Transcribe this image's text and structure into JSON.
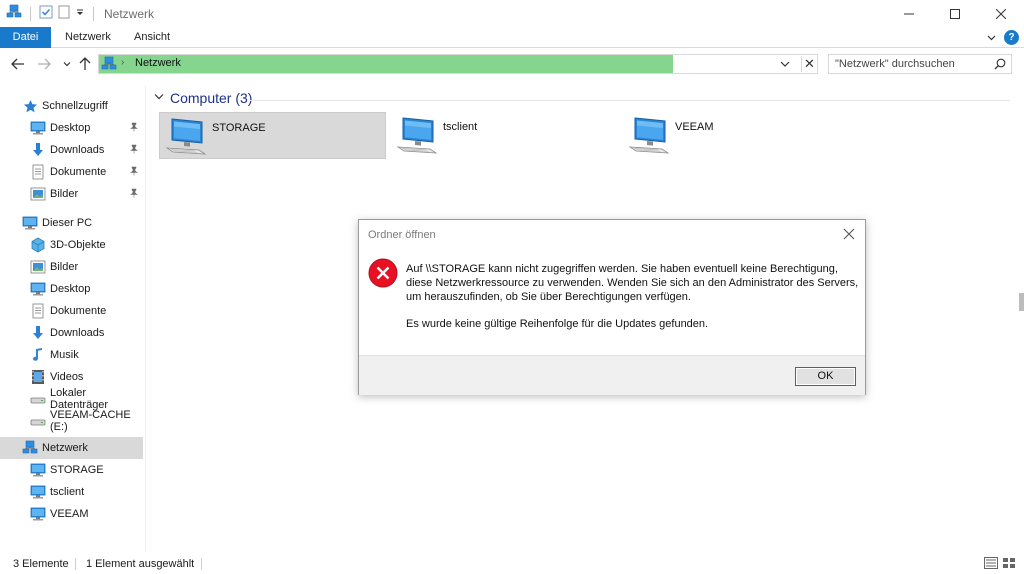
{
  "window": {
    "title": "Netzwerk"
  },
  "ribbon": {
    "tabs": [
      {
        "label": "Datei"
      },
      {
        "label": "Netzwerk"
      },
      {
        "label": "Ansicht"
      }
    ],
    "help_label": "?"
  },
  "address": {
    "path": "Netzwerk",
    "progress_fraction": 0.8,
    "progress_color": "#86d58f"
  },
  "search": {
    "placeholder": "\"Netzwerk\" durchsuchen"
  },
  "sidebar": {
    "quick_access": {
      "label": "Schnellzugriff",
      "items": [
        {
          "label": "Desktop",
          "icon": "desktop-icon",
          "pinned": true
        },
        {
          "label": "Downloads",
          "icon": "download-icon",
          "pinned": true
        },
        {
          "label": "Dokumente",
          "icon": "document-icon",
          "pinned": true
        },
        {
          "label": "Bilder",
          "icon": "pictures-icon",
          "pinned": true
        }
      ]
    },
    "this_pc": {
      "label": "Dieser PC",
      "items": [
        {
          "label": "3D-Objekte",
          "icon": "3d-objects-icon"
        },
        {
          "label": "Bilder",
          "icon": "pictures-icon"
        },
        {
          "label": "Desktop",
          "icon": "desktop-icon"
        },
        {
          "label": "Dokumente",
          "icon": "document-icon"
        },
        {
          "label": "Downloads",
          "icon": "download-icon"
        },
        {
          "label": "Musik",
          "icon": "music-icon"
        },
        {
          "label": "Videos",
          "icon": "video-icon"
        },
        {
          "label": "Lokaler Datenträger",
          "icon": "drive-icon"
        },
        {
          "label": "VEEAM-CACHE (E:)",
          "icon": "drive-icon"
        }
      ]
    },
    "network": {
      "label": "Netzwerk",
      "selected": true,
      "items": [
        {
          "label": "STORAGE",
          "icon": "computer-icon"
        },
        {
          "label": "tsclient",
          "icon": "computer-icon"
        },
        {
          "label": "VEEAM",
          "icon": "computer-icon"
        }
      ]
    }
  },
  "content": {
    "group_label": "Computer (3)",
    "items": [
      {
        "name": "STORAGE",
        "selected": true
      },
      {
        "name": "tsclient",
        "selected": false
      },
      {
        "name": "VEEAM",
        "selected": false
      }
    ]
  },
  "status": {
    "count": "3 Elemente",
    "selection": "1 Element ausgewählt"
  },
  "dialog": {
    "title": "Ordner öffnen",
    "message": "Auf \\\\STORAGE kann nicht zugegriffen werden. Sie haben eventuell keine Berechtigung, diese Netzwerkressource zu verwenden. Wenden Sie sich an den Administrator des Servers, um herauszufinden, ob Sie über Berechtigungen verfügen.",
    "detail": "Es wurde keine gültige Reihenfolge für die Updates gefunden.",
    "ok_label": "OK",
    "icon": "error-icon",
    "error_color": "#e81123"
  },
  "colors": {
    "accent": "#1979ca",
    "group_header": "#1e3287",
    "selection": "#d9d9d9"
  }
}
